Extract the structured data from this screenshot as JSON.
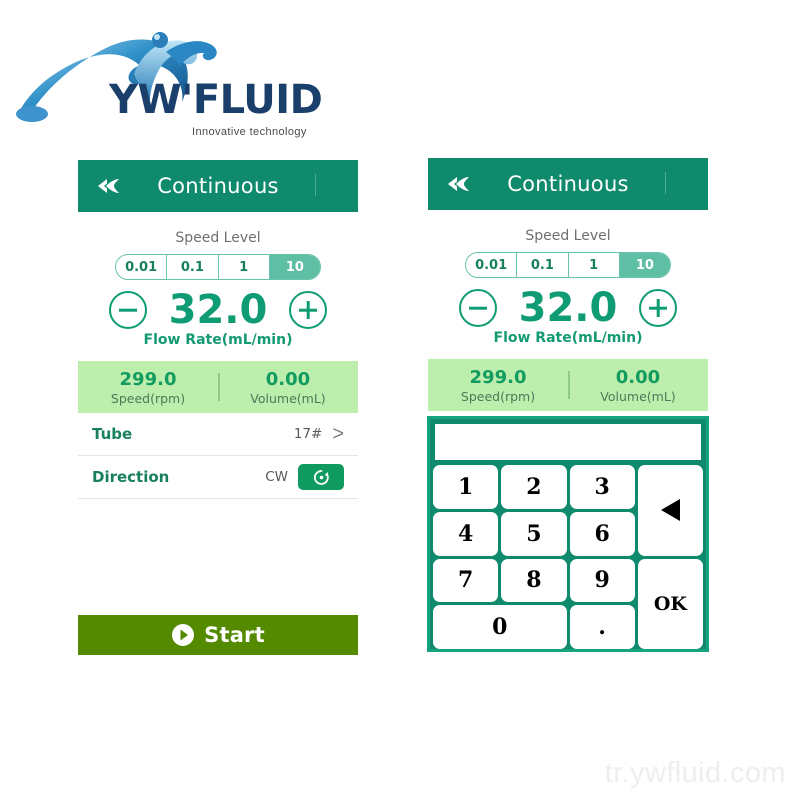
{
  "brand": {
    "logo_text": "YW'FLUID",
    "tagline": "Innovative  technology",
    "logo_icon": "water-swoosh-icon",
    "logo_color": "#1b3f6b",
    "accent_color": "#0f8a6d"
  },
  "watermark": "tr.ywfluid.com",
  "panel_left": {
    "topbar": {
      "title": "Continuous",
      "back_icon": "double-chevron-left-icon"
    },
    "speed_level": {
      "label": "Speed Level",
      "options": [
        "0.01",
        "0.1",
        "1",
        "10"
      ],
      "selected": "10",
      "selected_index": 3,
      "active_color": "#5fbfa4"
    },
    "flow_rate": {
      "decrement_icon": "minus-circle-icon",
      "increment_icon": "plus-circle-icon",
      "value": "32.0",
      "unit_label": "Flow Rate(mL/min)",
      "value_color": "#0f9c74"
    },
    "stats": {
      "background": "#bdeeae",
      "items": [
        {
          "value": "299.0",
          "caption": "Speed(rpm)"
        },
        {
          "value": "0.00",
          "caption": "Volume(mL)"
        }
      ]
    },
    "rows": [
      {
        "label": "Tube",
        "value": "17#",
        "chevron": ">",
        "icon": "chevron-right-icon"
      },
      {
        "label": "Direction",
        "value": "CW",
        "icon": "clockwise-rotation-icon"
      }
    ],
    "start_button": {
      "label": "Start",
      "icon": "play-circle-icon",
      "color": "#538a00"
    }
  },
  "panel_right": {
    "topbar": {
      "title": "Continuous",
      "back_icon": "double-chevron-left-icon"
    },
    "speed_level": {
      "label": "Speed Level",
      "options": [
        "0.01",
        "0.1",
        "1",
        "10"
      ],
      "selected": "10",
      "selected_index": 3
    },
    "flow_rate": {
      "value": "32.0",
      "unit_label": "Flow Rate(mL/min)"
    },
    "stats": {
      "items": [
        {
          "value": "299.0",
          "caption": "Speed(rpm)"
        },
        {
          "value": "0.00",
          "caption": "Volume(mL)"
        }
      ]
    },
    "keypad": {
      "display_value": "",
      "display_placeholder": "",
      "keys": [
        {
          "label": "1",
          "name": "key-1"
        },
        {
          "label": "2",
          "name": "key-2"
        },
        {
          "label": "3",
          "name": "key-3"
        },
        {
          "label": "4",
          "name": "key-4"
        },
        {
          "label": "5",
          "name": "key-5"
        },
        {
          "label": "6",
          "name": "key-6"
        },
        {
          "label": "7",
          "name": "key-7"
        },
        {
          "label": "8",
          "name": "key-8"
        },
        {
          "label": "9",
          "name": "key-9"
        },
        {
          "label": "0",
          "name": "key-0"
        },
        {
          "label": ".",
          "name": "key-decimal"
        }
      ],
      "backspace_icon": "backspace-arrow-left-icon",
      "ok_label": "OK",
      "border_color": "#16a47f"
    }
  }
}
